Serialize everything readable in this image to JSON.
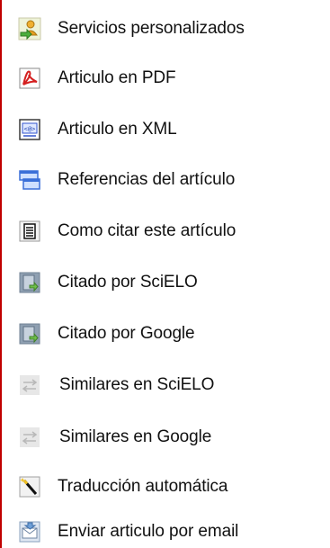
{
  "menu": {
    "items": [
      {
        "id": "servicios",
        "label": "Servicios personalizados",
        "icon": "user-services-icon"
      },
      {
        "id": "pdf",
        "label": "Articulo en PDF",
        "icon": "pdf-icon"
      },
      {
        "id": "xml",
        "label": "Articulo en XML",
        "icon": "xml-icon"
      },
      {
        "id": "referencias",
        "label": "Referencias del artículo",
        "icon": "references-icon"
      },
      {
        "id": "citar",
        "label": "Como citar este artículo",
        "icon": "citation-icon"
      },
      {
        "id": "citado-scielo",
        "label": "Citado por SciELO",
        "icon": "cited-by-icon"
      },
      {
        "id": "citado-google",
        "label": "Citado por Google",
        "icon": "cited-by-icon"
      },
      {
        "id": "similares-scielo",
        "label": "Similares en SciELO",
        "icon": "similar-icon"
      },
      {
        "id": "similares-google",
        "label": "Similares en Google",
        "icon": "similar-icon"
      },
      {
        "id": "traduccion",
        "label": "Traducción automática",
        "icon": "magic-wand-icon"
      },
      {
        "id": "email",
        "label": "Enviar articulo por email",
        "icon": "email-icon"
      }
    ]
  },
  "colors": {
    "border": "#c00000",
    "text": "#111111"
  }
}
